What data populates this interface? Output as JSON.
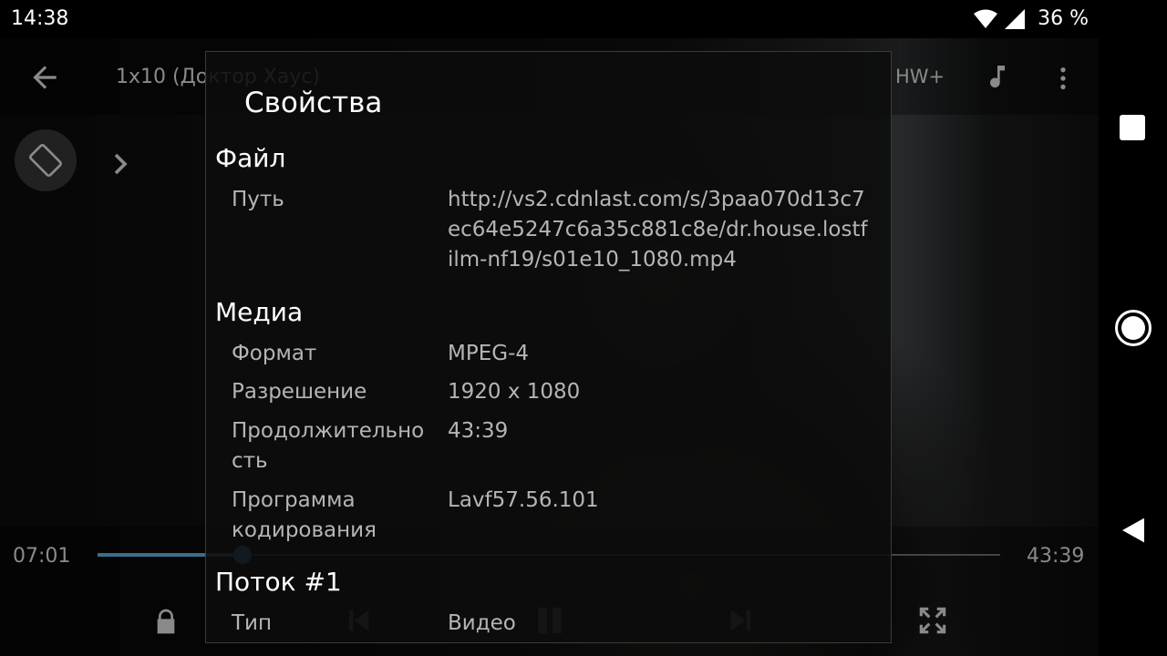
{
  "status_bar": {
    "time": "14:38",
    "battery": "36 %"
  },
  "player": {
    "title": "1x10 (Доктор Хаус)",
    "decoder": "HW+",
    "current_time": "07:01",
    "total_time": "43:39",
    "progress": 0.161
  },
  "dialog": {
    "title": "Свойства",
    "sections": [
      {
        "name": "Файл",
        "rows": [
          {
            "key": "Путь",
            "value": "http://vs2.cdnlast.com/s/3paa070d13c7ec64e5247c6a35c881c8e/dr.house.lostfilm-nf19/s01e10_1080.mp4"
          }
        ]
      },
      {
        "name": "Медиа",
        "rows": [
          {
            "key": "Формат",
            "value": "MPEG-4"
          },
          {
            "key": "Разрешение",
            "value": "1920 x 1080"
          },
          {
            "key": "Продолжительность",
            "value": "43:39"
          },
          {
            "key": "Программа кодирования",
            "value": "Lavf57.56.101"
          }
        ]
      },
      {
        "name": "Поток #1",
        "rows": [
          {
            "key": "Тип",
            "value": "Видео"
          }
        ]
      }
    ]
  },
  "icons": {
    "back": "arrow-back-icon",
    "audio": "music-note-icon",
    "menu": "more-vert-icon",
    "rotate": "screen-rotation-icon",
    "expand": "chevron-right-icon",
    "lock": "lock-icon",
    "prev": "skip-previous-icon",
    "play": "pause-icon",
    "next": "skip-next-icon",
    "fullscreen": "fullscreen-icon"
  },
  "colors": {
    "accent": "#3f7aa3"
  }
}
